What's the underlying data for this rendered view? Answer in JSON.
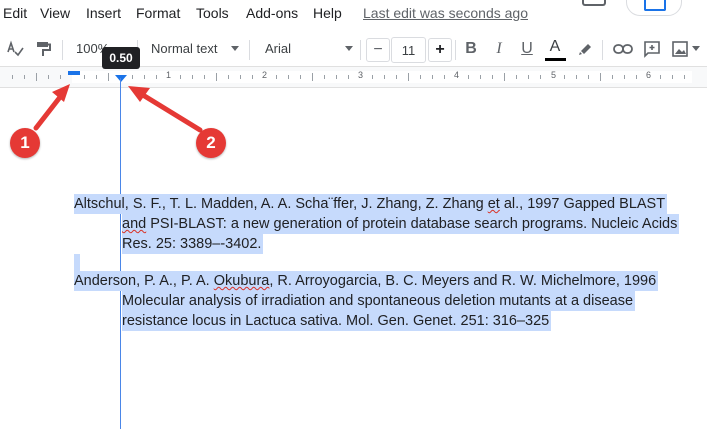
{
  "menu": {
    "items": [
      "Edit",
      "View",
      "Insert",
      "Format",
      "Tools",
      "Add-ons",
      "Help"
    ],
    "last_edit": "Last edit was seconds ago"
  },
  "toolbar": {
    "zoom": "100%",
    "style": "Normal text",
    "font": "Arial",
    "font_size": "11",
    "minus": "−",
    "plus": "+",
    "bold": "B",
    "italic": "I",
    "underline": "U",
    "text_color": "A"
  },
  "ruler": {
    "numbers": [
      "1",
      "2",
      "3",
      "4",
      "5",
      "6"
    ],
    "tooltip": "0.50"
  },
  "document": {
    "ref1": {
      "line1a": "Altschul, S. F., T. L. Madden, A. A. Scha¨ffer, J. Zhang, Z. Zhang ",
      "line1b": "et",
      "line1c": " al., 1997 Gapped BLAST",
      "line2a": "and",
      "line2b": " PSI-BLAST: a new generation of protein database search programs. Nucleic Acids",
      "line3": "Res. 25: 3389–-3402."
    },
    "ref2": {
      "line1a": "Anderson, P. A., P. A. ",
      "line1b": "Okubura",
      "line1c": ", R. Arroyogarcia, B. C. Meyers and R. W. Michelmore, 1996",
      "line2": "Molecular analysis of irradiation and spontaneous deletion mutants at a disease",
      "line3": "resistance locus in Lactuca sativa. Mol. Gen. Genet. 251: 316–325"
    }
  },
  "annotations": {
    "badge1": "1",
    "badge2": "2",
    "color": "#e53935"
  },
  "colors": {
    "accent": "#1a73e8",
    "selection": "#c6dafc"
  }
}
